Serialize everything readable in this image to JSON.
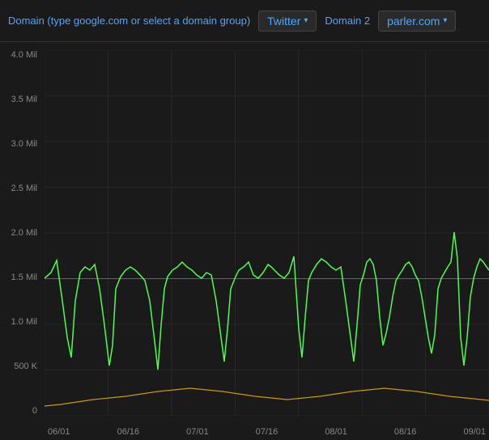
{
  "header": {
    "domain_label": "Domain (type google.com or select a domain group)",
    "twitter_btn": "Twitter",
    "domain2_label": "Domain 2",
    "parler_btn": "parler.com"
  },
  "chart": {
    "y_labels": [
      "4.0 Mil",
      "3.5 Mil",
      "3.0 Mil",
      "2.5 Mil",
      "2.0 Mil",
      "1.5 Mil",
      "1.0 Mil",
      "500 K",
      "0"
    ],
    "x_labels": [
      "06/01",
      "06/16",
      "07/01",
      "07/16",
      "08/01",
      "08/16",
      "09/01"
    ],
    "colors": {
      "green": "#4cff4c",
      "yellow": "#ccaa00",
      "white_line": "#cccccc"
    }
  }
}
